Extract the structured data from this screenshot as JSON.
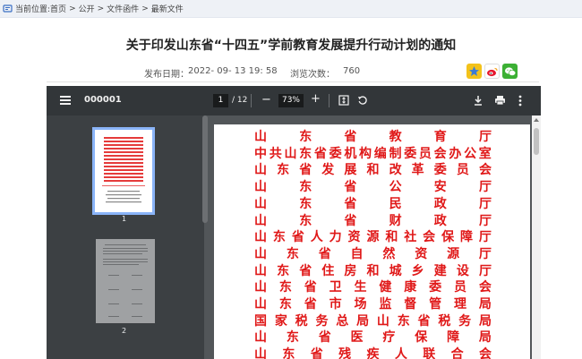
{
  "breadcrumb": {
    "label": "当前位置:",
    "items": [
      "首页",
      "公开",
      "文件函件",
      "最新文件"
    ],
    "separator": ">"
  },
  "article": {
    "title": "关于印发山东省“十四五”学前教育发展提升行动计划的通知",
    "date_label": "发布日期：",
    "date": "2022- 09- 13 19: 58",
    "views_label": "浏览次数：",
    "views": "760"
  },
  "share": {
    "icons": [
      "qzone-icon",
      "weibo-icon",
      "wechat-icon"
    ]
  },
  "viewer": {
    "filename": "000001",
    "current_page": "1",
    "total_pages": "/ 12",
    "zoom": "73%",
    "zoom_out_label": "−",
    "zoom_in_label": "+",
    "thumbnails": [
      {
        "page": "1"
      },
      {
        "page": "2"
      }
    ]
  },
  "document": {
    "issuers": [
      "山东省教育厅",
      "中共山东省委机构编制委员会办公室",
      "山东省发展和改革委员会",
      "山东省公安厅",
      "山东省民政厅",
      "山东省财政厅",
      "山东省人力资源和社会保障厅",
      "山东省自然资源厅",
      "山东省住房和城乡建设厅",
      "山东省卫生健康委员会",
      "山东省市场监督管理局",
      "国家税务总局山东省税务局",
      "山东省医疗保障局",
      "山东省残疾人联合会"
    ],
    "text_color": "#e01818"
  },
  "colors": {
    "toolbar": "#323639",
    "viewer_bg": "#525659",
    "thumb_highlight": "#8ab4f8"
  }
}
